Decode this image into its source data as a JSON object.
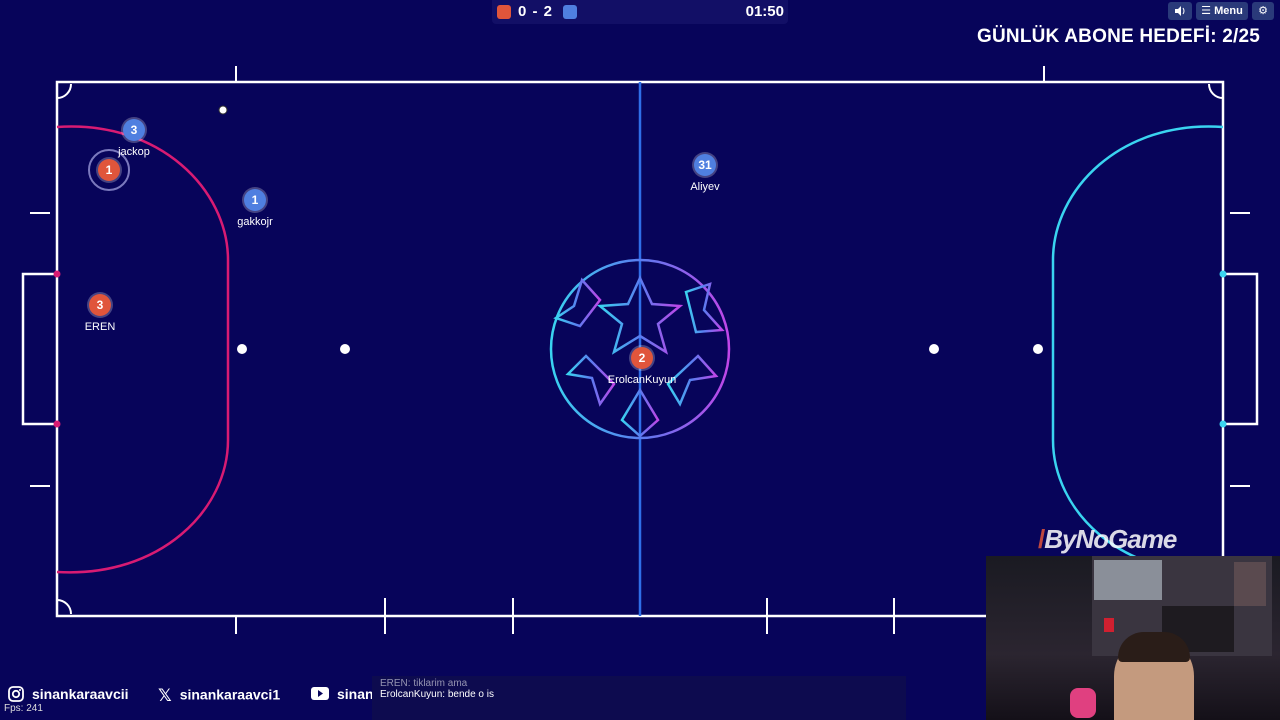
{
  "scoreboard": {
    "red_color": "#e0553b",
    "blue_color": "#4f7fe0",
    "score_text": "0 - 2",
    "clock": "01:50"
  },
  "top_buttons": {
    "sound_icon": "speaker-icon",
    "menu_label": "☰ Menu",
    "settings_icon": "gear-icon"
  },
  "overlay_goal": "GÜNLÜK ABONE HEDEFİ: 2/25",
  "players": [
    {
      "team": "blue",
      "number": "3",
      "name": "jackop"
    },
    {
      "team": "red",
      "number": "1",
      "name": ""
    },
    {
      "team": "blue",
      "number": "1",
      "name": "gakkojr"
    },
    {
      "team": "red",
      "number": "3",
      "name": "EREN"
    },
    {
      "team": "blue",
      "number": "31",
      "name": "Aliyev"
    },
    {
      "team": "red",
      "number": "2",
      "name": "ErolcanKuyun"
    }
  ],
  "colors": {
    "left_area": "#d81b73",
    "right_area": "#3ad4f0",
    "center_line": "#2f6ee8",
    "lines": "#ffffff"
  },
  "socials": {
    "instagram": "sinankaraavcii",
    "x": "sinankaraavci1",
    "youtube": "sinankaraavci"
  },
  "fps": "Fps: 241",
  "chat": {
    "line1": "EREN: tiklarim ama",
    "line2": "ErolcanKuyun: bende o is"
  },
  "brand": "ByNoGame"
}
